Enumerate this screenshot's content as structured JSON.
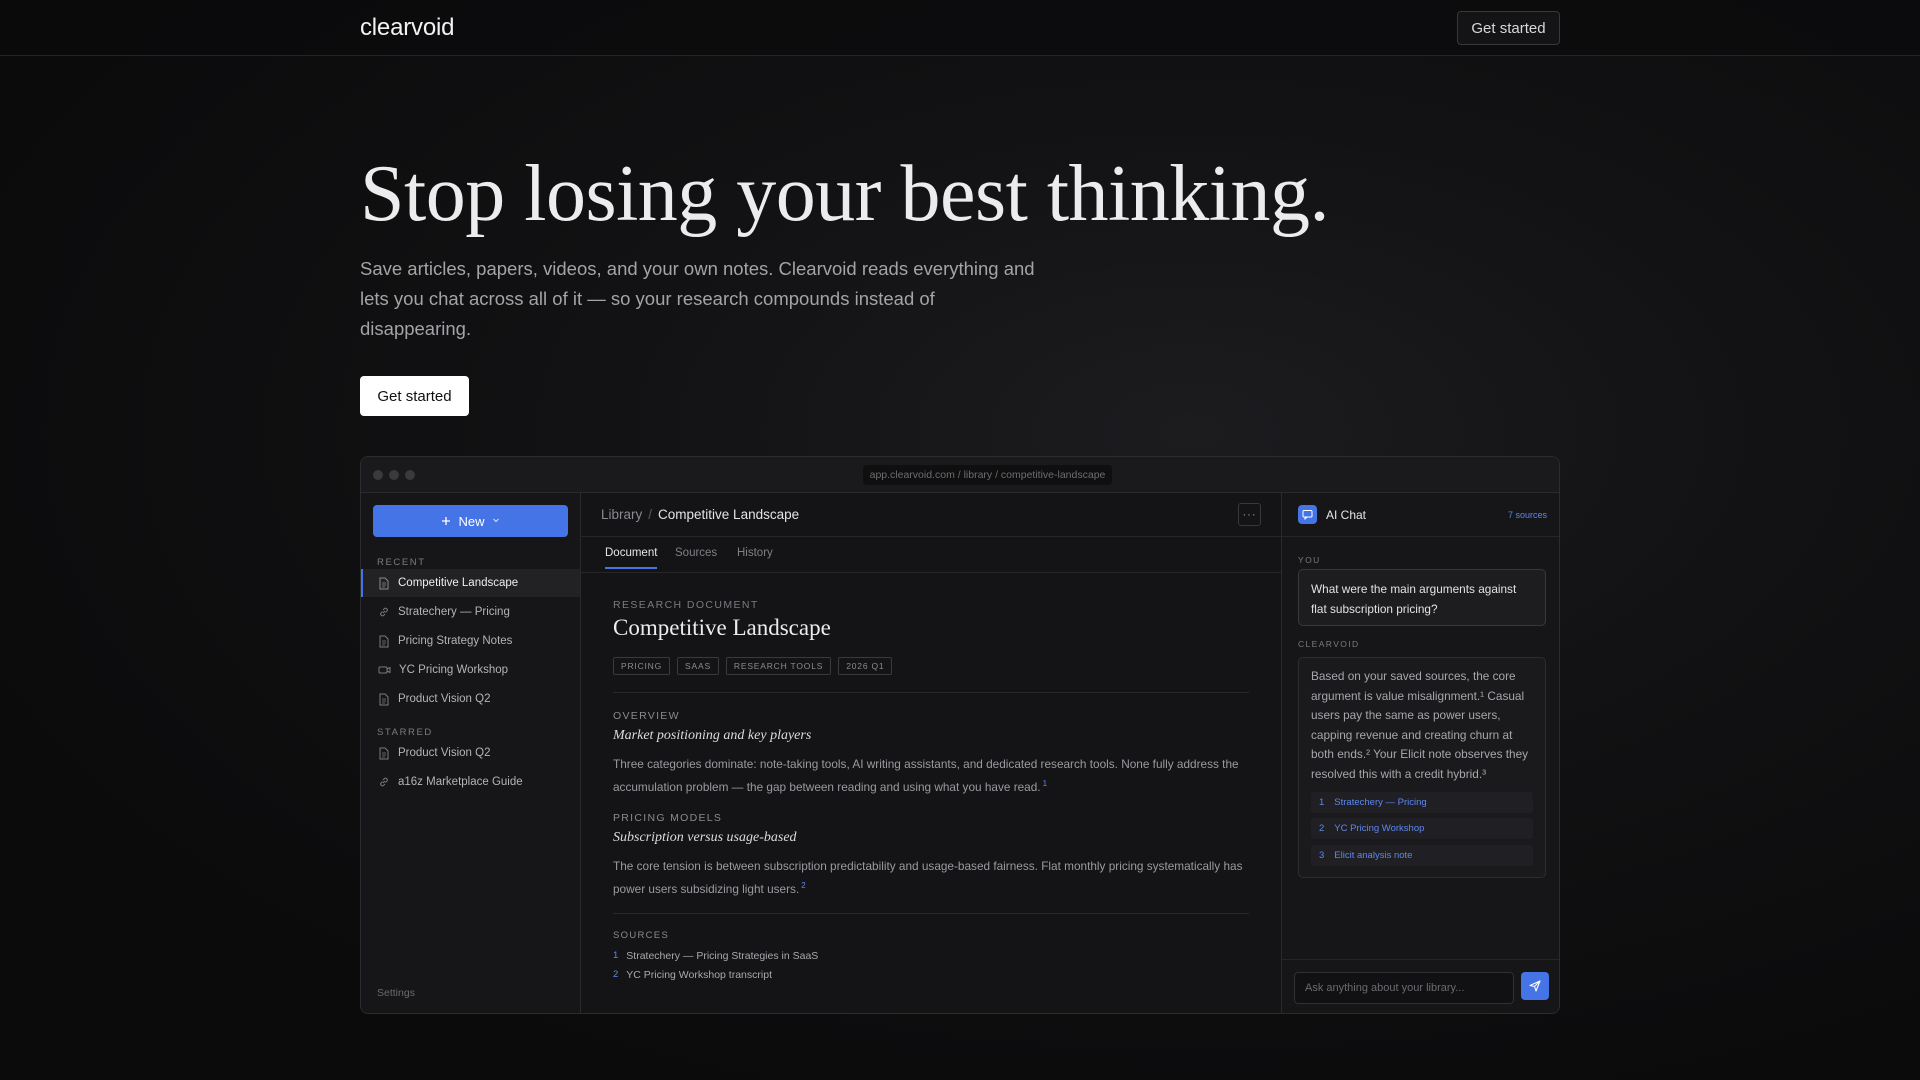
{
  "nav": {
    "brand": "clearvoid",
    "cta_label": "Get started"
  },
  "hero": {
    "title": "Stop losing your best thinking.",
    "subtitle": "Save articles, papers, videos, and your own notes. Clearvoid reads everything and lets you chat across all of it — so your research compounds instead of disappearing.",
    "cta_label": "Get started"
  },
  "window": {
    "url": "app.clearvoid.com / library / competitive-landscape"
  },
  "sidebar": {
    "new_label": "New",
    "recent_label": "RECENT",
    "recent": [
      {
        "label": "Competitive Landscape",
        "icon": "document-icon"
      },
      {
        "label": "Stratechery — Pricing",
        "icon": "link-icon"
      },
      {
        "label": "Pricing Strategy Notes",
        "icon": "document-icon"
      },
      {
        "label": "YC Pricing Workshop",
        "icon": "video-icon"
      },
      {
        "label": "Product Vision Q2",
        "icon": "document-icon"
      }
    ],
    "starred_label": "STARRED",
    "starred": [
      {
        "label": "Product Vision Q2",
        "icon": "document-icon"
      },
      {
        "label": "a16z Marketplace Guide",
        "icon": "link-icon"
      }
    ],
    "settings_label": "Settings"
  },
  "main": {
    "breadcrumb": {
      "root": "Library",
      "separator": "/",
      "current": "Competitive Landscape"
    },
    "more_label": "···",
    "tabs": [
      "Document",
      "Sources",
      "History"
    ],
    "doc": {
      "eyebrow": "RESEARCH DOCUMENT",
      "title": "Competitive Landscape",
      "tags": [
        "PRICING",
        "SAAS",
        "RESEARCH TOOLS",
        "2026 Q1"
      ],
      "sections": [
        {
          "label": "OVERVIEW",
          "heading": "Market positioning and key players",
          "body": "Three categories dominate: note-taking tools, AI writing assistants, and dedicated research tools. None fully address the accumulation problem — the gap between reading and using what you have read.",
          "cite": "1"
        },
        {
          "label": "PRICING MODELS",
          "heading": "Subscription versus usage-based",
          "body": "The core tension is between subscription predictability and usage-based fairness. Flat monthly pricing systematically has power users subsidizing light users.",
          "cite": "2"
        }
      ],
      "sources_label": "SOURCES",
      "sources": [
        {
          "n": "1",
          "label": "Stratechery — Pricing Strategies in SaaS"
        },
        {
          "n": "2",
          "label": "YC Pricing Workshop transcript"
        }
      ]
    }
  },
  "chat": {
    "title": "AI Chat",
    "count": "7 sources",
    "you_label": "YOU",
    "question": "What were the main arguments against flat subscription pricing?",
    "ai_label": "CLEARVOID",
    "answer": "Based on your saved sources, the core argument is value misalignment.¹ Casual users pay the same as power users, capping revenue and creating churn at both ends.² Your Elicit note observes they resolved this with a credit hybrid.³",
    "citations": [
      {
        "n": "1",
        "label": "Stratechery — Pricing"
      },
      {
        "n": "2",
        "label": "YC Pricing Workshop"
      },
      {
        "n": "3",
        "label": "Elicit analysis note"
      }
    ],
    "input_placeholder": "Ask anything about your library..."
  },
  "colors": {
    "accent": "#4574e6",
    "link": "#5d87f0",
    "background": "#121214"
  }
}
